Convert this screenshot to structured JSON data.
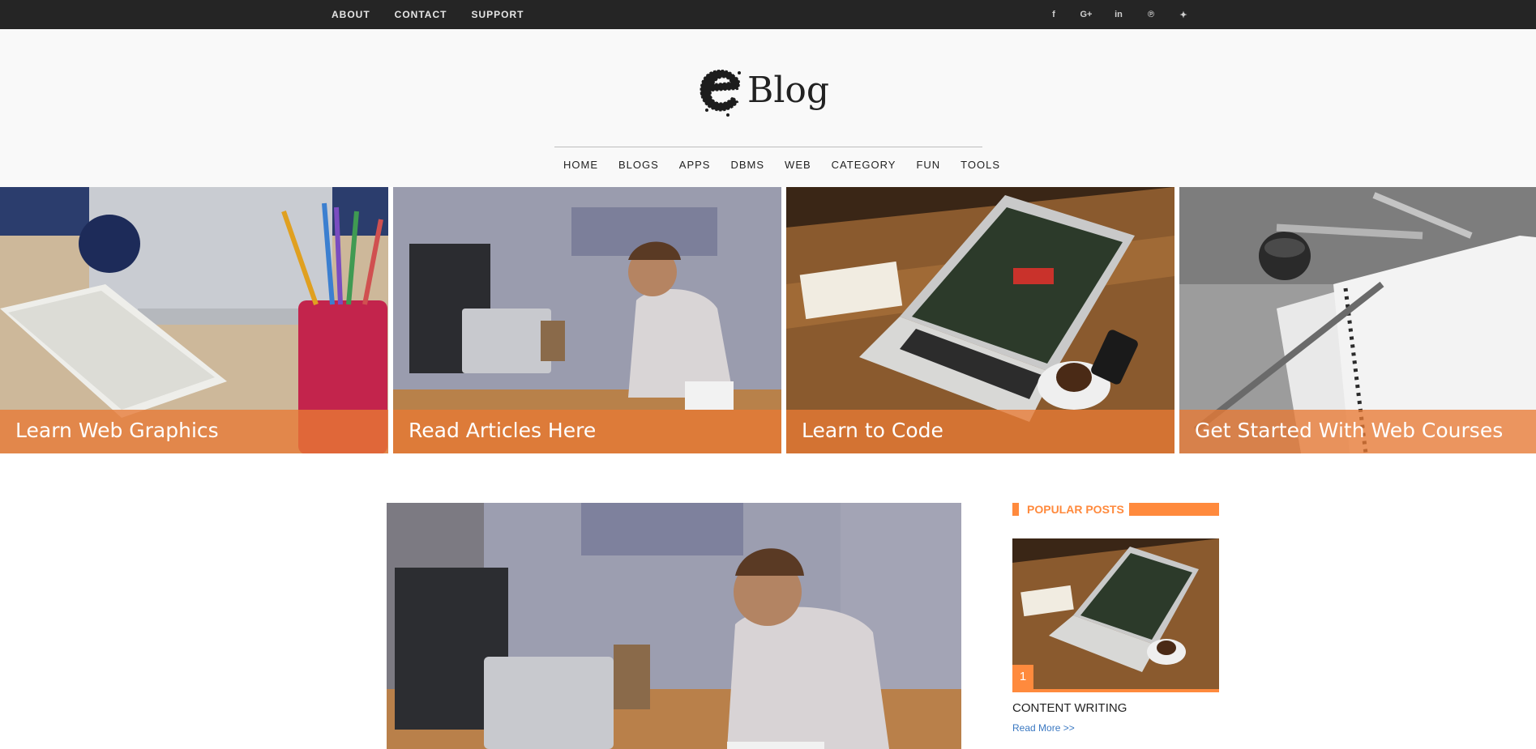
{
  "topbar": {
    "links": [
      "ABOUT",
      "CONTACT",
      "SUPPORT"
    ],
    "social": [
      {
        "icon": "facebook-icon",
        "glyph": "f"
      },
      {
        "icon": "google-plus-icon",
        "glyph": "G+"
      },
      {
        "icon": "linkedin-icon",
        "glyph": "in"
      },
      {
        "icon": "pinterest-icon",
        "glyph": "℗"
      },
      {
        "icon": "twitter-icon",
        "glyph": "✦"
      }
    ]
  },
  "header": {
    "logo_text": "Blog",
    "nav": [
      "HOME",
      "BLOGS",
      "APPS",
      "DBMS",
      "WEB",
      "CATEGORY",
      "FUN",
      "TOOLS"
    ]
  },
  "slider": {
    "slides": [
      {
        "caption": "Learn Web Graphics",
        "image": "desk-with-keyboard-and-pencils"
      },
      {
        "caption": "Read Articles Here",
        "image": "man-working-on-laptop"
      },
      {
        "caption": "Learn to Code",
        "image": "laptop-on-wooden-table"
      },
      {
        "caption": "Get Started With Web Courses",
        "image": "notebook-and-pens"
      }
    ]
  },
  "feature": {
    "image": "man-working-on-laptop"
  },
  "sidebar": {
    "widget_title": "POPULAR POSTS",
    "post": {
      "number": "1",
      "title": "CONTENT WRITING",
      "read_more": "Read More >>",
      "image": "laptop-on-wooden-table"
    }
  },
  "colors": {
    "accent": "#ff8a3d",
    "topbar": "#252525",
    "header_bg": "#f9f9f9",
    "link": "#3a78c2"
  }
}
